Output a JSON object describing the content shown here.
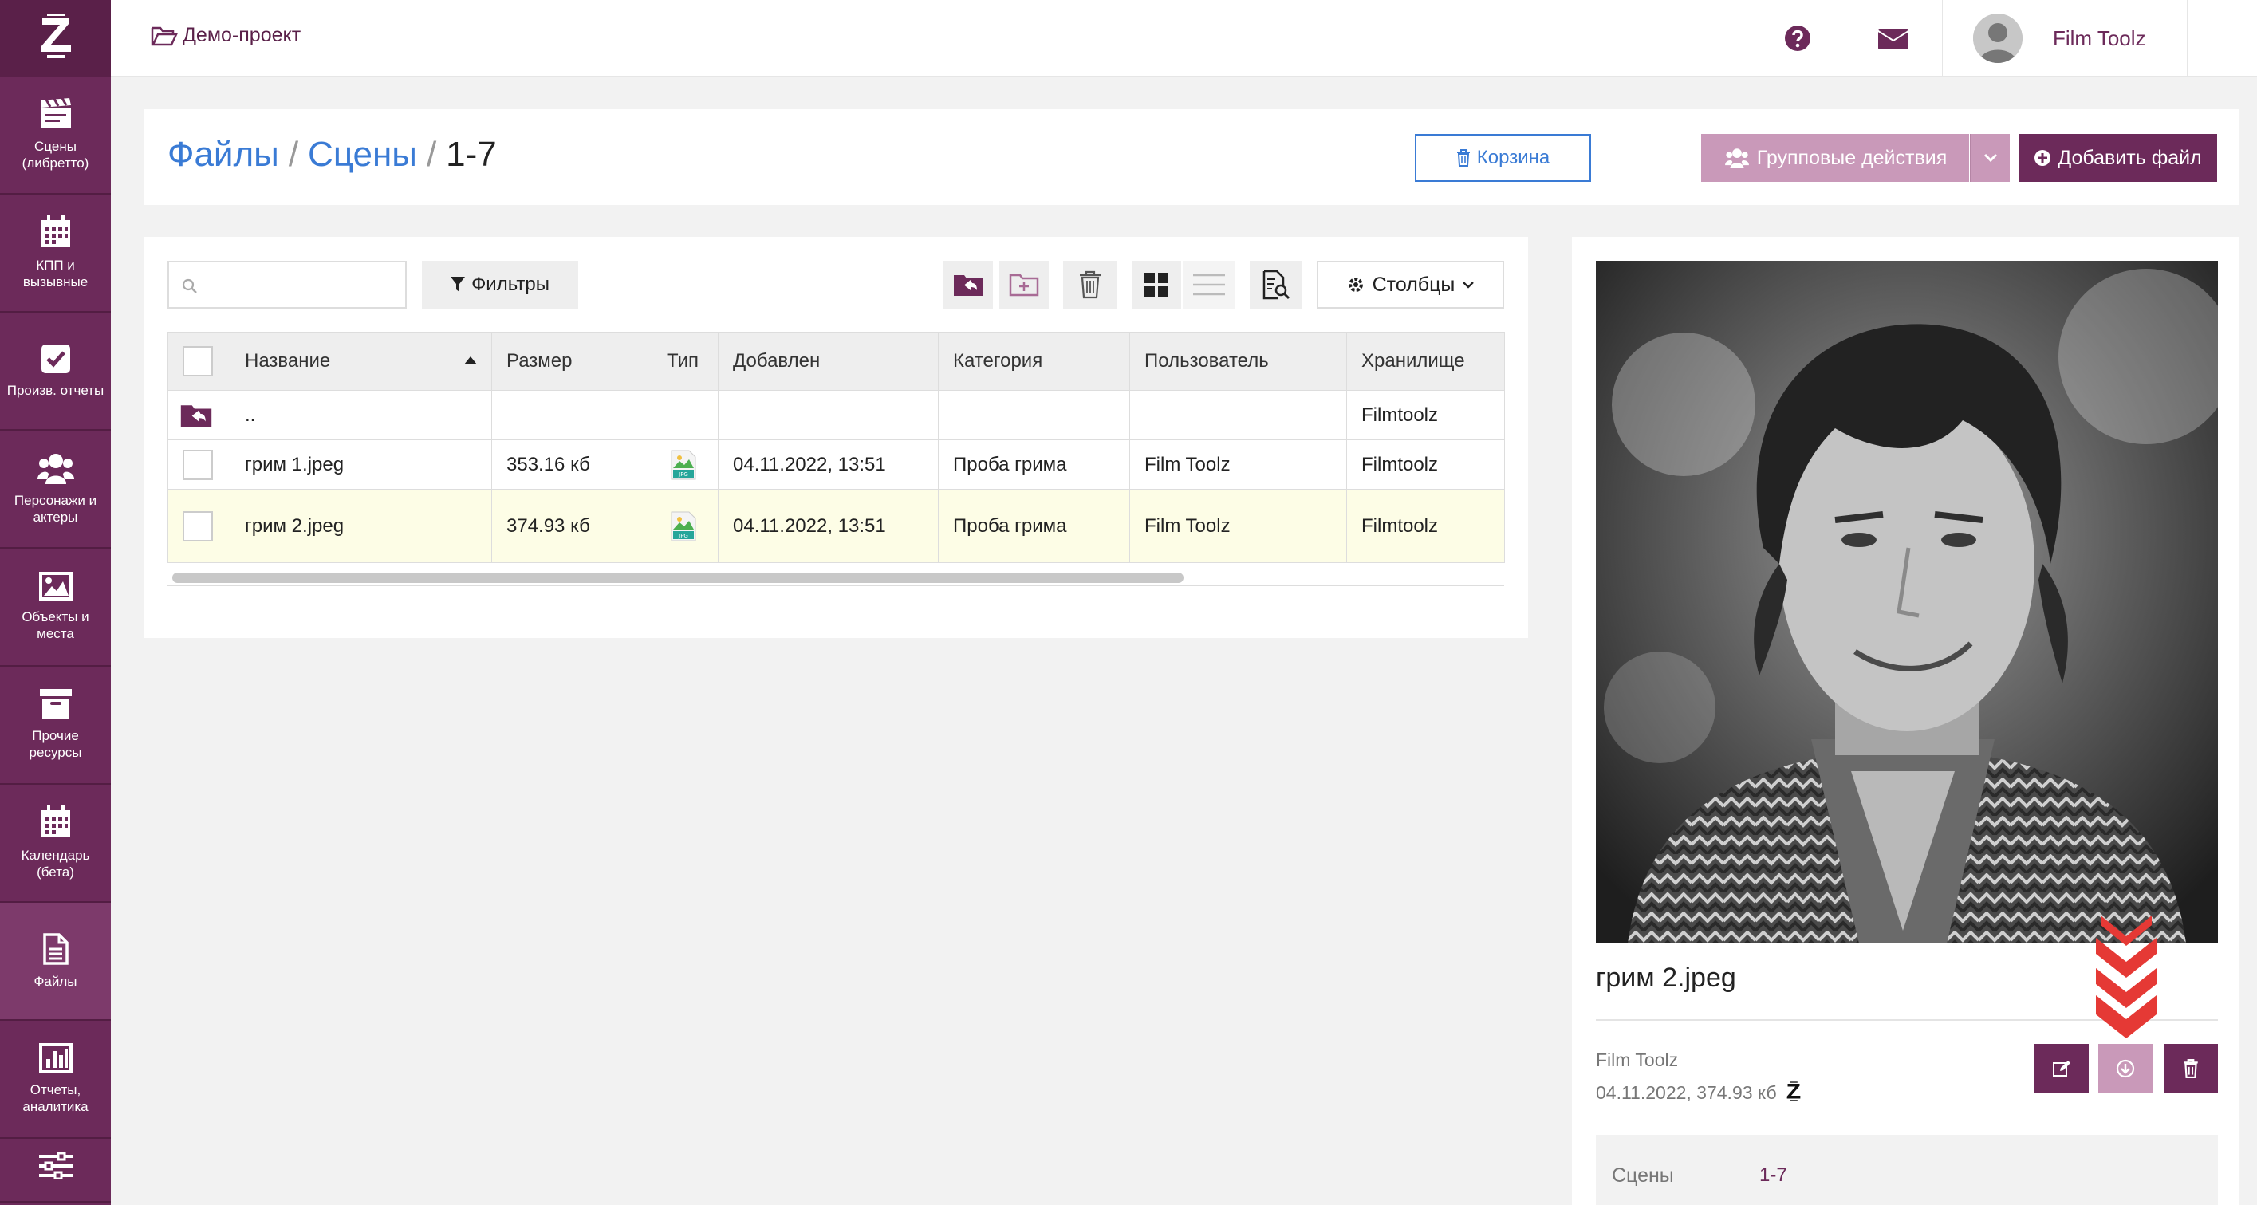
{
  "sidebar": {
    "items": [
      {
        "label": "Сцены (либретто)",
        "icon": "clapperboard-icon"
      },
      {
        "label": "КПП и вызывные",
        "icon": "calendar-icon"
      },
      {
        "label": "Произв. отчеты",
        "icon": "checkbox-icon"
      },
      {
        "label": "Персонажи и актеры",
        "icon": "users-icon"
      },
      {
        "label": "Объекты и места",
        "icon": "image-icon"
      },
      {
        "label": "Прочие ресурсы",
        "icon": "archive-icon"
      },
      {
        "label": "Календарь (бета)",
        "icon": "calendar-icon"
      },
      {
        "label": "Файлы",
        "icon": "file-icon"
      },
      {
        "label": "Отчеты, аналитика",
        "icon": "bar-chart-icon"
      },
      {
        "label": "",
        "icon": "sliders-icon"
      }
    ],
    "active_index": 7
  },
  "topbar": {
    "project": "Демо-проект",
    "user_name": "Film Toolz",
    "language": "RU"
  },
  "breadcrumb": {
    "root": "Файлы",
    "section": "Сцены",
    "current": "1-7",
    "separator": "/"
  },
  "header_buttons": {
    "trash": "Корзина",
    "group_actions": "Групповые действия",
    "add_file": "Добавить файл"
  },
  "toolbar": {
    "search_placeholder": "",
    "filters": "Фильтры",
    "columns": "Столбцы"
  },
  "table": {
    "columns": [
      "Название",
      "Размер",
      "Тип",
      "Добавлен",
      "Категория",
      "Пользователь",
      "Хранилище"
    ],
    "parent_row": {
      "name": "..",
      "storage": "Filmtoolz"
    },
    "rows": [
      {
        "name": "грим 1.jpeg",
        "size": "353.16 кб",
        "type": "JPG",
        "added": "04.11.2022, 13:51",
        "category": "Проба грима",
        "user": "Film Toolz",
        "storage": "Filmtoolz"
      },
      {
        "name": "грим 2.jpeg",
        "size": "374.93 кб",
        "type": "JPG",
        "added": "04.11.2022, 13:51",
        "category": "Проба грима",
        "user": "Film Toolz",
        "storage": "Filmtoolz"
      }
    ],
    "selected_index": 1
  },
  "preview": {
    "filename": "грим 2.jpeg",
    "user": "Film Toolz",
    "date_size": "04.11.2022, 374.93 кб",
    "property_key": "Сцены",
    "property_value": "1-7"
  },
  "colors": {
    "brand": "#6c2a5a",
    "brand_light": "#c999b9",
    "link": "#3a7bd5",
    "highlight_row": "#fdfde6",
    "arrow": "#e53935"
  }
}
